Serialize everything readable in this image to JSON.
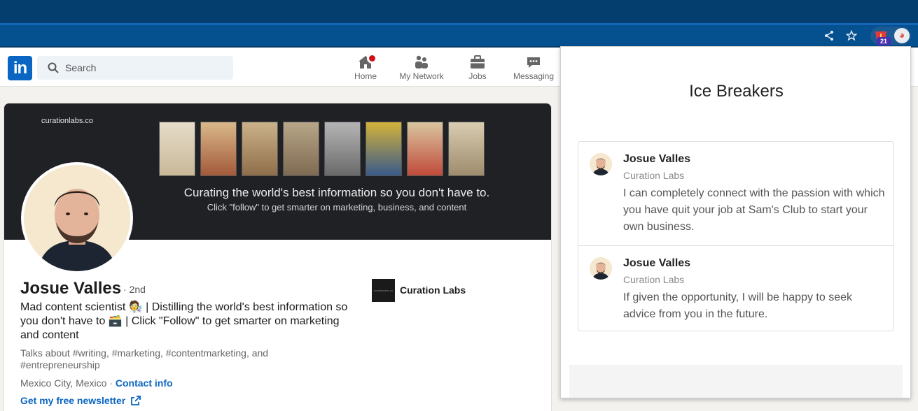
{
  "browser": {
    "extension_badge": "21"
  },
  "linkedin": {
    "logo_text": "in",
    "search_placeholder": "Search",
    "nav": [
      {
        "label": "Home",
        "icon": "home-icon"
      },
      {
        "label": "My Network",
        "icon": "network-icon"
      },
      {
        "label": "Jobs",
        "icon": "jobs-icon"
      },
      {
        "label": "Messaging",
        "icon": "messaging-icon"
      }
    ]
  },
  "profile": {
    "banner_site": "curationlabs.co",
    "banner_tagline": "Curating the world's best information so you don't have to.",
    "banner_subtitle": "Click \"follow\" to get smarter on marketing, business, and content",
    "name": "Josue Valles",
    "degree": "· 2nd",
    "headline": "Mad content scientist 🧑‍🔬 | Distilling the world's best information so you don't have to 🗃️ | Click \"Follow\" to get smarter on marketing and content",
    "talks_about": "Talks about #writing, #marketing, #contentmarketing, and #entrepreneurship",
    "location": "Mexico City, Mexico ·",
    "contact_label": "Contact info",
    "newsletter_label": "Get my free newsletter",
    "company": "Curation Labs",
    "company_logo_text": "curationlabs.co"
  },
  "popup": {
    "title": "Ice Breakers",
    "breakers": [
      {
        "name": "Josue Valles",
        "company": "Curation Labs",
        "text": "I can completely connect with the passion with which you have quit your job at Sam's Club to start your own business."
      },
      {
        "name": "Josue Valles",
        "company": "Curation Labs",
        "text": "If given the opportunity, I will be happy to seek advice from you in the future."
      }
    ]
  },
  "colors": {
    "linkedin_blue": "#0a66c2",
    "chrome_dark": "#033e6e",
    "chrome_bar": "#05508f",
    "notification_red": "#cc1016"
  }
}
